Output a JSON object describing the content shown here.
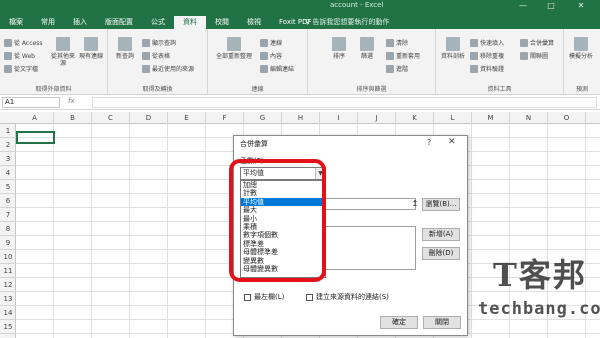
{
  "window": {
    "title": "account - Excel",
    "controls": [
      "—",
      "□",
      "✕"
    ]
  },
  "tabs": [
    {
      "label": "檔案",
      "active": false
    },
    {
      "label": "常用",
      "active": false
    },
    {
      "label": "插入",
      "active": false
    },
    {
      "label": "版面配置",
      "active": false
    },
    {
      "label": "公式",
      "active": false
    },
    {
      "label": "資料",
      "active": true
    },
    {
      "label": "校閱",
      "active": false
    },
    {
      "label": "檢視",
      "active": false
    },
    {
      "label": "Foxit PDF",
      "active": false
    }
  ],
  "tell_me": "♀ 告訴我您想要執行的動作",
  "ribbon": {
    "get_external": {
      "items": [
        "從 Access",
        "從 Web",
        "從文字檔"
      ],
      "big": [
        "從其他來源",
        "現有連線"
      ],
      "label": "取得外部資料"
    },
    "get_transform": {
      "big": [
        "新查詢"
      ],
      "items": [
        "顯示查詢",
        "從表格",
        "最近使用的來源"
      ],
      "label": "取得及轉換"
    },
    "connections": {
      "big": [
        "全部重新整理"
      ],
      "items": [
        "連線",
        "內容",
        "編輯連結"
      ],
      "label": "連線"
    },
    "sort_filter": {
      "big": [
        "排序",
        "篩選"
      ],
      "items": [
        "清除",
        "重新套用",
        "進階"
      ],
      "label": "排序與篩選"
    },
    "data_tools": {
      "big": [
        "資料剖析"
      ],
      "items": [
        "快速填入",
        "移除重複",
        "資料驗證",
        "合併彙算",
        "關聯圖"
      ],
      "label": "資料工具"
    },
    "forecast": {
      "big": [
        "模擬分析"
      ],
      "label": "預測"
    }
  },
  "formula_bar": {
    "name_box": "A1",
    "fx": "fx",
    "content": ""
  },
  "columns": [
    "A",
    "B",
    "C",
    "D",
    "E",
    "F",
    "G",
    "H",
    "I",
    "J",
    "K",
    "L",
    "M",
    "N",
    "O"
  ],
  "rows": [
    "1",
    "2",
    "3",
    "4",
    "5",
    "6",
    "7",
    "8",
    "9",
    "10",
    "11",
    "12",
    "13",
    "14",
    "15"
  ],
  "dialog": {
    "title": "合併彙算",
    "help": "?",
    "close": "✕",
    "function_label": "函數(F):",
    "function_selected": "平均值",
    "function_options": [
      "加總",
      "計數",
      "平均值",
      "最大",
      "最小",
      "乘積",
      "數字項個數",
      "標準差",
      "母體標準差",
      "變異數",
      "母體變異數"
    ],
    "function_highlighted_index": 2,
    "ref_collapse": "↥",
    "browse": "瀏覽(B)...",
    "add": "新增(A)",
    "delete": "刪除(D)",
    "left_column": "最左欄(L)",
    "link_source": "建立來源資料的連結(S)",
    "ok": "確定",
    "close_button": "關閉"
  },
  "watermark": {
    "logo": "T客邦",
    "site": "techbang.com"
  }
}
